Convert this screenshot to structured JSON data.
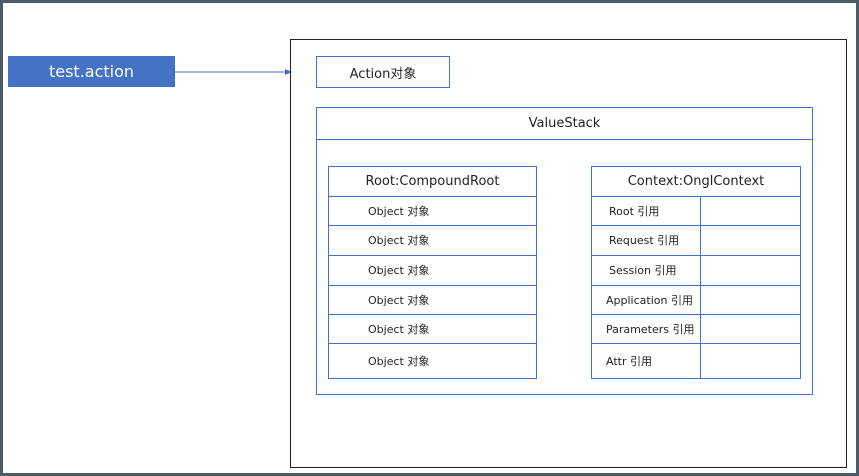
{
  "source": {
    "label": "test.action"
  },
  "action_object": {
    "label": "Action对象"
  },
  "value_stack": {
    "title": "ValueStack",
    "root": {
      "title": "Root:CompoundRoot",
      "rows": [
        "Object 对象",
        "Object 对象",
        "Object 对象",
        "Object 对象",
        "Object 对象",
        "Object 对象"
      ]
    },
    "context": {
      "title": "Context:OnglContext",
      "rows": [
        "Root 引用",
        "Request 引用",
        "Session 引用",
        "Application 引用",
        "Parameters 引用",
        "Attr 引用"
      ]
    }
  },
  "colors": {
    "accent": "#4472c4",
    "border": "#222222",
    "frame": "#4a5a66"
  }
}
